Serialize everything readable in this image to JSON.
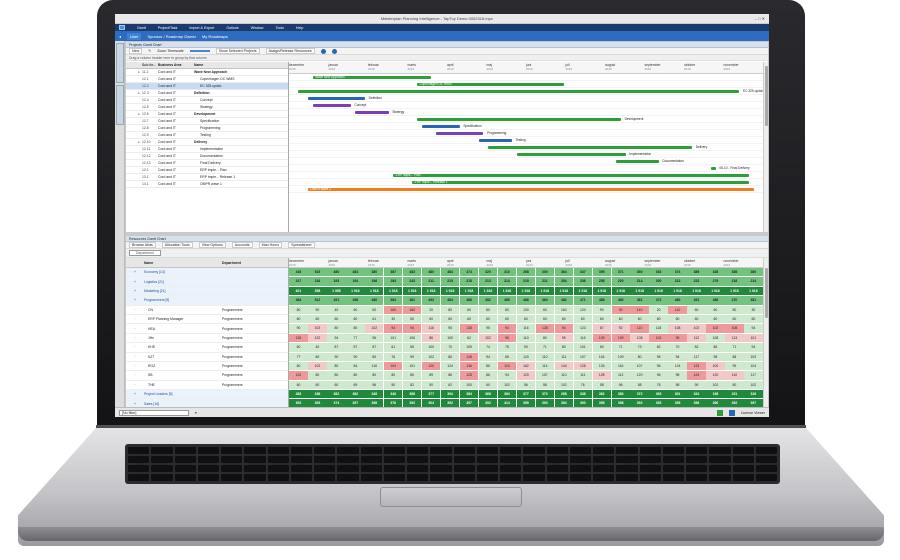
{
  "window": {
    "title": "Meisterplan Planning Intelligence - TapToy Demo 0002316.mpx"
  },
  "ribbon": {
    "items": [
      "Gantt",
      "Project/Task",
      "Import & Export",
      "Outlook",
      "Window",
      "Tools",
      "Help"
    ]
  },
  "nav": {
    "user": "User",
    "crumb1": "Sponsor / Roadmap Owner",
    "crumb2": "My Roadmaps"
  },
  "projects_pane": {
    "title": "Projects Gantt Chart",
    "toolbar": {
      "new": "New",
      "zoom": "Zoom Timescale",
      "show_selected": "Show Selected Projects",
      "assign": "Assign/Release Resources"
    },
    "group_hint": "Drag a column header here to group by that column",
    "columns": [
      "Sub ite...",
      "Business Area",
      "Name"
    ],
    "rows": [
      {
        "idx": "",
        "id": "11.2",
        "area": "Cord and IT",
        "name": "Wave New Approach"
      },
      {
        "idx": "",
        "id": "12.1",
        "area": "Cord and IT",
        "name": "Copenhagen DC WMS"
      },
      {
        "idx": "",
        "id": "12.2",
        "area": "Cord and IT",
        "name": "EC 325 updat.."
      },
      {
        "idx": "",
        "id": "12.3",
        "area": "Cord and IT",
        "name": "Definition"
      },
      {
        "idx": "",
        "id": "12.4",
        "area": "Cord and IT",
        "name": "Concept"
      },
      {
        "idx": "",
        "id": "12.5",
        "area": "Cord and IT",
        "name": "Strategy"
      },
      {
        "idx": "",
        "id": "12.6",
        "area": "Cord and IT",
        "name": "Development"
      },
      {
        "idx": "",
        "id": "12.7",
        "area": "Cord and IT",
        "name": "Specification"
      },
      {
        "idx": "",
        "id": "12.8",
        "area": "Cord and IT",
        "name": "Programming"
      },
      {
        "idx": "",
        "id": "12.9",
        "area": "Cord and IT",
        "name": "Testing"
      },
      {
        "idx": "",
        "id": "12.10",
        "area": "Cord and IT",
        "name": "Delivery"
      },
      {
        "idx": "",
        "id": "12.11",
        "area": "Cord and IT",
        "name": "Implementation"
      },
      {
        "idx": "",
        "id": "12.12",
        "area": "Cord and IT",
        "name": "Documentation"
      },
      {
        "idx": "",
        "id": "12.13",
        "area": "Cord and IT",
        "name": "Final Delivery"
      },
      {
        "idx": "",
        "id": "12.1",
        "area": "Cord and IT",
        "name": "ERP imple... Plan"
      },
      {
        "idx": "",
        "id": "13.1",
        "area": "Cord and IT",
        "name": "ERP imple... Release 1"
      },
      {
        "idx": "",
        "id": "14.1",
        "area": "Cord and IT",
        "name": "OMPR wave 1"
      }
    ],
    "months": [
      {
        "name": "december",
        "year": "2015"
      },
      {
        "name": "januar",
        "year": "2016"
      },
      {
        "name": "februar",
        "year": "2016"
      },
      {
        "name": "marts",
        "year": "2016"
      },
      {
        "name": "april",
        "year": "2016"
      },
      {
        "name": "maj",
        "year": "2016"
      },
      {
        "name": "juni",
        "year": "2016"
      },
      {
        "name": "juli",
        "year": "2016"
      },
      {
        "name": "august",
        "year": "2016"
      },
      {
        "name": "september",
        "year": "2016"
      },
      {
        "name": "oktober",
        "year": "2016"
      },
      {
        "name": "november",
        "year": "2016"
      }
    ],
    "bar_labels": {
      "r0": "Wave New Approach",
      "r1": "Copenhagen DC WMS",
      "r2": "EC 325 updat..",
      "r3": "Definition",
      "r4": "Concept",
      "r5": "Strategy",
      "r6": "Development",
      "r7": "Specification",
      "r8": "Programming",
      "r9": "Testing",
      "r10": "Delivery",
      "r11": "Implementation",
      "r12": "Documentation",
      "r13": "06-10 - Final Delivery",
      "r14": "ERP imple... Plan",
      "r15": "ERP imple... Release 1",
      "r16": "OMPR wave 1"
    }
  },
  "resources_pane": {
    "title": "Resources Gantt Chart",
    "toolbar": {
      "browse": "Browse Atlas",
      "allocation": "Allocation Tools",
      "view_options": "View Options",
      "accounts": "Accounts",
      "man_hours": "Man Hours",
      "spreadsheet": "Spreadsheet"
    },
    "group_select": "Department",
    "columns": [
      "Name",
      "Department"
    ],
    "rows": [
      {
        "name": "Economy [14]",
        "dept": "",
        "summary": true
      },
      {
        "name": "Logistics [21]",
        "dept": "",
        "summary": true
      },
      {
        "name": "Marketing [21]",
        "dept": "",
        "summary": true
      },
      {
        "name": "Programmers [9]",
        "dept": "",
        "summary": true
      },
      {
        "name": "CN",
        "dept": "Programmers",
        "summary": false
      },
      {
        "name": "ERP Planning Manager",
        "dept": "Programmers",
        "summary": false
      },
      {
        "name": "HEA",
        "dept": "Programmers",
        "summary": false
      },
      {
        "name": "JHn",
        "dept": "Programmers",
        "summary": false
      },
      {
        "name": "KHE",
        "dept": "Programmers",
        "summary": false
      },
      {
        "name": "KZT",
        "dept": "Programmers",
        "summary": false
      },
      {
        "name": "RGZ",
        "dept": "Programmers",
        "summary": false
      },
      {
        "name": "SB",
        "dept": "Programmers",
        "summary": false
      },
      {
        "name": "THE",
        "dept": "Programmers",
        "summary": false
      },
      {
        "name": "Project Leaders [5]",
        "dept": "",
        "summary": true
      },
      {
        "name": "Sales [16]",
        "dept": "",
        "summary": true
      }
    ],
    "heat_values": [
      [
        "416",
        "515",
        "480",
        "484",
        "380",
        "387",
        "483",
        "480",
        "484",
        "474",
        "320",
        "310",
        "268",
        "300",
        "364",
        "347",
        "395",
        "371",
        "350",
        "353",
        "374",
        "389",
        "328",
        "358",
        "360"
      ],
      [
        "317",
        "216",
        "193",
        "194",
        "196",
        "194",
        "243",
        "211",
        "215",
        "215",
        "213",
        "214",
        "215",
        "211",
        "254",
        "236",
        "258",
        "220",
        "214",
        "200",
        "213",
        "222",
        "279",
        "218",
        "214"
      ],
      [
        "621",
        "258",
        "1 958",
        "1 918",
        "1 918",
        "1 918",
        "1 918",
        "1 918",
        "1 918",
        "1 918",
        "1 918",
        "1 918",
        "1 918",
        "1 918",
        "1 918",
        "1 918",
        "1 918",
        "1 918",
        "1 918",
        "1 918",
        "1 918",
        "1 918",
        "1 918",
        "1 918",
        "1 918"
      ],
      [
        "484",
        "512",
        "491",
        "498",
        "480",
        "484",
        "481",
        "492",
        "484",
        "488",
        "482",
        "485",
        "466",
        "460",
        "482",
        "471",
        "488",
        "480",
        "481",
        "472",
        "480",
        "491",
        "486",
        "470",
        "481"
      ],
      [
        "80",
        "90",
        "40",
        "60",
        "60",
        "160",
        "160",
        "20",
        "80",
        "60",
        "80",
        "80",
        "100",
        "60",
        "160",
        "120",
        "90",
        "30",
        "140",
        "20",
        "110",
        "60",
        "60",
        "80",
        "30"
      ],
      [
        "60",
        "60",
        "60",
        "60",
        "61",
        "30",
        "60",
        "60",
        "60",
        "60",
        "60",
        "60",
        "60",
        "60",
        "60",
        "60",
        "60",
        "60",
        "60",
        "60",
        "60",
        "60",
        "60",
        "60",
        "60"
      ],
      [
        "90",
        "102",
        "80",
        "80",
        "102",
        "94",
        "94",
        "116",
        "95",
        "138",
        "95",
        "94",
        "116",
        "128",
        "94",
        "123",
        "87",
        "92",
        "110",
        "118",
        "108",
        "102",
        "102",
        "108",
        "94"
      ],
      [
        "130",
        "122",
        "94",
        "77",
        "96",
        "101",
        "106",
        "86",
        "100",
        "62",
        "102",
        "96",
        "110",
        "80",
        "95",
        "116",
        "109",
        "109",
        "108",
        "102",
        "95",
        "112",
        "108",
        "113",
        "101"
      ],
      [
        "60",
        "40",
        "87",
        "57",
        "87",
        "61",
        "55",
        "100",
        "70",
        "109",
        "74",
        "75",
        "90",
        "71",
        "80",
        "101",
        "69",
        "71",
        "73",
        "82",
        "70",
        "82",
        "86",
        "71",
        "94"
      ],
      [
        "77",
        "80",
        "90",
        "90",
        "80",
        "76",
        "99",
        "102",
        "86",
        "128",
        "94",
        "85",
        "120",
        "110",
        "111",
        "107",
        "104",
        "109",
        "80",
        "96",
        "94",
        "117",
        "98",
        "88",
        "103"
      ],
      [
        "80",
        "102",
        "80",
        "84",
        "116",
        "104",
        "101",
        "120",
        "124",
        "136",
        "86",
        "124",
        "162",
        "114",
        "144",
        "128",
        "133",
        "116",
        "107",
        "96",
        "124",
        "124",
        "100",
        "99",
        "104"
      ],
      [
        "120",
        "80",
        "80",
        "80",
        "80",
        "80",
        "80",
        "89",
        "86",
        "128",
        "86",
        "94",
        "120",
        "107",
        "110",
        "111",
        "128",
        "112",
        "120",
        "96",
        "98",
        "124",
        "120",
        "110",
        "117"
      ],
      [
        "60",
        "60",
        "60",
        "69",
        "96",
        "50",
        "82",
        "90",
        "62",
        "100",
        "60",
        "102",
        "56",
        "58",
        "102",
        "76",
        "58",
        "96",
        "58",
        "78",
        "58",
        "90",
        "102",
        "80",
        "102"
      ],
      [
        "283",
        "188",
        "382",
        "382",
        "348",
        "346",
        "388",
        "377",
        "394",
        "384",
        "368",
        "384",
        "377",
        "370",
        "288",
        "338",
        "362",
        "383",
        "372",
        "263",
        "301",
        "324",
        "198",
        "231",
        "319"
      ],
      [
        "392",
        "393",
        "374",
        "397",
        "398",
        "376",
        "393",
        "304",
        "392",
        "397",
        "392",
        "414",
        "395",
        "393",
        "394",
        "393",
        "398",
        "398",
        "392",
        "393",
        "395",
        "398",
        "390",
        "392",
        "397"
      ]
    ],
    "heat_tones": [
      "gggggggggggggggggggggggggg",
      "gggggggggggggggggggggggggg",
      "DDDDDDDDDDDDDDDDDDDDDDDDDD",
      "gggggggggggggggggggggggggg",
      "lllllrrllllllllllrrlrllllll",
      "lllllllllllllllllllllllllll",
      "lpllprrplrlrlrrlpprlpprrlpp",
      "rplllllpllprllplrrprrplpprp",
      "lllllllllllllllllllllllllll",
      "lllllllllrlllllllllllllllll",
      "lplllrlrlrlrplpplllllrpllll",
      "rllllllllrllplllpllllrpplll",
      "lllllllllllllllllllllllllll",
      "DDDDDDDDDDDDDDDDDDDDDDDDDD",
      "DDDDDDDDDDDDDDDDDDDDDDDDDD"
    ]
  },
  "status": {
    "filter": "[No filter]",
    "viewer": "License Viewer"
  },
  "colors": {
    "nav": "#2d6cc0",
    "ribbon": "#1b3a6e",
    "bar_green": "#2e9e3a",
    "bar_blue": "#2566b7",
    "bar_purple": "#7b3fb8",
    "bar_orange": "#f07d1e"
  }
}
